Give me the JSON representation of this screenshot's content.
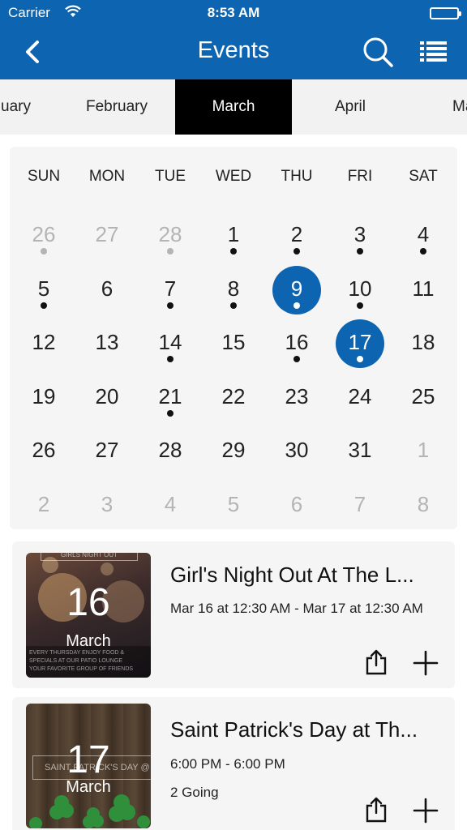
{
  "status_bar": {
    "carrier": "Carrier",
    "time": "8:53 AM"
  },
  "header": {
    "title": "Events",
    "icons": {
      "back": "chevron-left-icon",
      "search": "search-icon",
      "list": "list-icon"
    }
  },
  "months": [
    "uary",
    "February",
    "March",
    "April",
    "Ma"
  ],
  "selected_month": "March",
  "calendar": {
    "weekdays": [
      "SUN",
      "MON",
      "TUE",
      "WED",
      "THU",
      "FRI",
      "SAT"
    ],
    "weeks": [
      [
        {
          "d": "26",
          "muted": true,
          "dot": true
        },
        {
          "d": "27",
          "muted": true,
          "dot": false
        },
        {
          "d": "28",
          "muted": true,
          "dot": true
        },
        {
          "d": "1",
          "muted": false,
          "dot": true
        },
        {
          "d": "2",
          "muted": false,
          "dot": true
        },
        {
          "d": "3",
          "muted": false,
          "dot": true
        },
        {
          "d": "4",
          "muted": false,
          "dot": true
        }
      ],
      [
        {
          "d": "5",
          "muted": false,
          "dot": true
        },
        {
          "d": "6",
          "muted": false,
          "dot": false
        },
        {
          "d": "7",
          "muted": false,
          "dot": true
        },
        {
          "d": "8",
          "muted": false,
          "dot": true
        },
        {
          "d": "9",
          "muted": false,
          "dot": true,
          "selected": true
        },
        {
          "d": "10",
          "muted": false,
          "dot": true
        },
        {
          "d": "11",
          "muted": false,
          "dot": false
        }
      ],
      [
        {
          "d": "12",
          "muted": false,
          "dot": false
        },
        {
          "d": "13",
          "muted": false,
          "dot": false
        },
        {
          "d": "14",
          "muted": false,
          "dot": true
        },
        {
          "d": "15",
          "muted": false,
          "dot": false
        },
        {
          "d": "16",
          "muted": false,
          "dot": true
        },
        {
          "d": "17",
          "muted": false,
          "dot": true,
          "selected": true
        },
        {
          "d": "18",
          "muted": false,
          "dot": false
        }
      ],
      [
        {
          "d": "19",
          "muted": false,
          "dot": false
        },
        {
          "d": "20",
          "muted": false,
          "dot": false
        },
        {
          "d": "21",
          "muted": false,
          "dot": true
        },
        {
          "d": "22",
          "muted": false,
          "dot": false
        },
        {
          "d": "23",
          "muted": false,
          "dot": false
        },
        {
          "d": "24",
          "muted": false,
          "dot": false
        },
        {
          "d": "25",
          "muted": false,
          "dot": false
        }
      ],
      [
        {
          "d": "26",
          "muted": false,
          "dot": false
        },
        {
          "d": "27",
          "muted": false,
          "dot": false
        },
        {
          "d": "28",
          "muted": false,
          "dot": false
        },
        {
          "d": "29",
          "muted": false,
          "dot": false
        },
        {
          "d": "30",
          "muted": false,
          "dot": false
        },
        {
          "d": "31",
          "muted": false,
          "dot": false
        },
        {
          "d": "1",
          "muted": true,
          "dot": false
        }
      ],
      [
        {
          "d": "2",
          "muted": true,
          "dot": false
        },
        {
          "d": "3",
          "muted": true,
          "dot": false
        },
        {
          "d": "4",
          "muted": true,
          "dot": false
        },
        {
          "d": "5",
          "muted": true,
          "dot": false
        },
        {
          "d": "6",
          "muted": true,
          "dot": false
        },
        {
          "d": "7",
          "muted": true,
          "dot": false
        },
        {
          "d": "8",
          "muted": true,
          "dot": false
        }
      ]
    ]
  },
  "events": [
    {
      "day": "16",
      "month": "March",
      "title": "Girl's Night Out At The L...",
      "lines": [
        "Mar 16 at 12:30 AM - Mar 17 at 12:30 AM"
      ],
      "thumb_text": [
        "GIRLS NIGHT OUT",
        "EVERY THURSDAY ENJOY FOOD &",
        "SPECIALS AT OUR PATIO LOUNGE",
        "YOUR FAVORITE GROUP OF FRIENDS"
      ]
    },
    {
      "day": "17",
      "month": "March",
      "title": "Saint Patrick's Day at Th...",
      "lines": [
        "6:00 PM - 6:00 PM",
        "2 Going"
      ],
      "thumb_text": [
        "SAINT PATRICK'S DAY @ T"
      ]
    }
  ],
  "colors": {
    "brand_blue": "#0d64b0",
    "month_active_bg": "#000000",
    "card_bg": "#f5f5f5"
  },
  "icons": {
    "share": "share-icon",
    "add": "plus-icon"
  }
}
